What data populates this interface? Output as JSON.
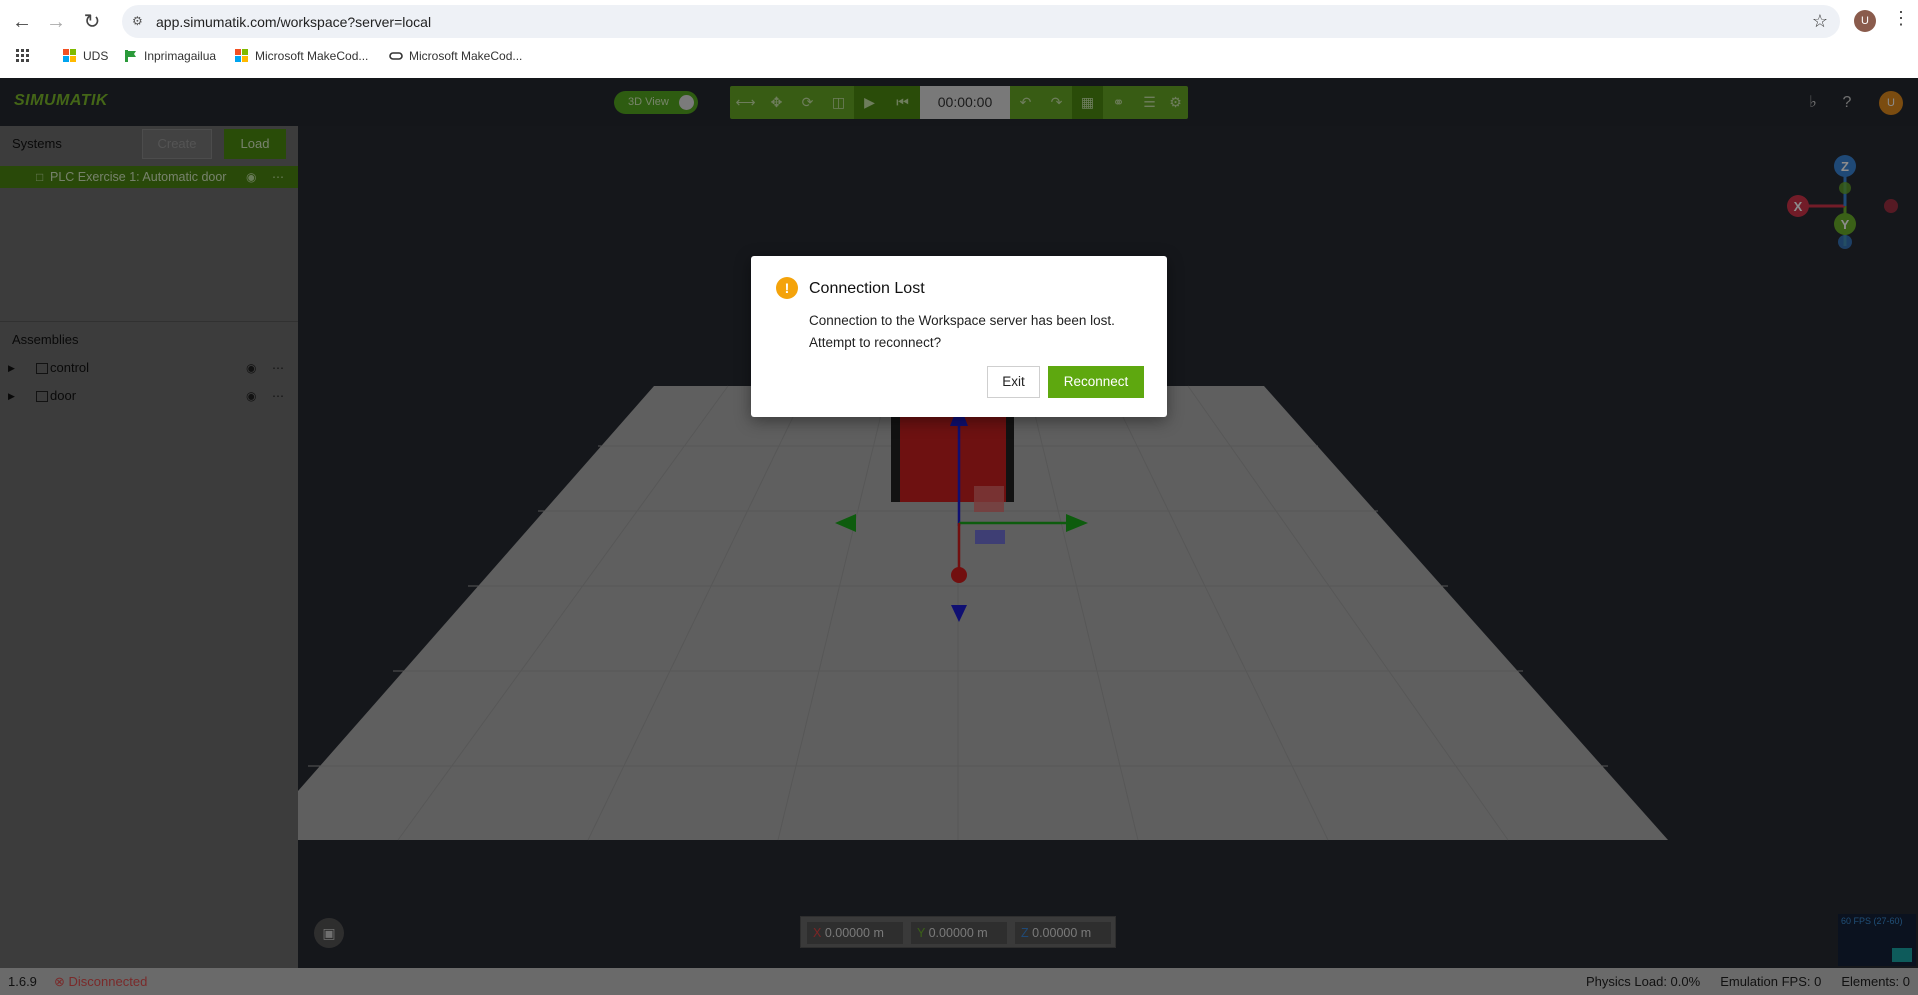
{
  "browser": {
    "url": "app.simumatik.com/workspace?server=local",
    "profile_initial": "U",
    "bookmarks": [
      {
        "label": "UDS"
      },
      {
        "label": "Inprimagailua"
      },
      {
        "label": "Microsoft MakeCod..."
      },
      {
        "label": "Microsoft MakeCod..."
      }
    ]
  },
  "app": {
    "logo": "SIMUMATIK",
    "view_toggle_label": "3D View",
    "time": "00:00:00",
    "user_initial": "U",
    "colors": {
      "accent": "#67a825",
      "warning": "#f4a30b"
    }
  },
  "sidebar": {
    "systems_title": "Systems",
    "create_label": "Create",
    "load_label": "Load",
    "system_item": "PLC Exercise 1: Automatic door",
    "assemblies_title": "Assemblies",
    "assemblies": [
      {
        "label": "control"
      },
      {
        "label": "door"
      }
    ]
  },
  "viewport": {
    "coords": {
      "x": "0.00000",
      "y": "0.00000",
      "z": "0.00000",
      "unit": "m"
    },
    "gizmo_axes": [
      "X",
      "Y",
      "Z"
    ],
    "fps": "60 FPS (27-60)"
  },
  "statusbar": {
    "version": "1.6.9",
    "connection": "Disconnected",
    "physics_load": "Physics Load: 0.0%",
    "emulation_fps": "Emulation FPS: 0",
    "elements": "Elements: 0"
  },
  "dialog": {
    "title": "Connection Lost",
    "message": "Connection to the Workspace server has been lost. Attempt to reconnect?",
    "exit_label": "Exit",
    "reconnect_label": "Reconnect"
  }
}
